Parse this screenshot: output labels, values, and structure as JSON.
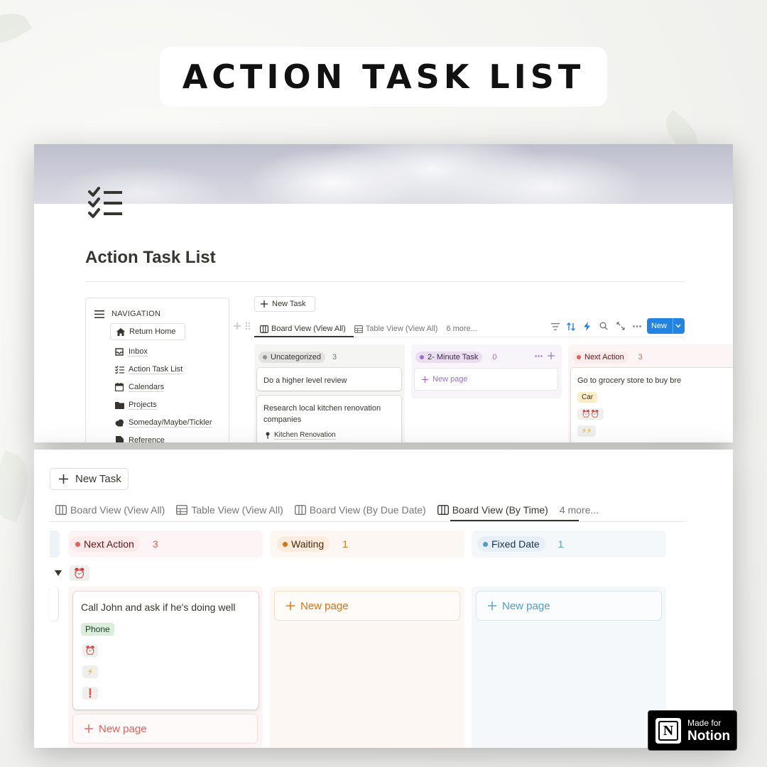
{
  "header": {
    "title": "ACTION TASK LIST"
  },
  "top": {
    "page_title": "Action Task List",
    "nav_heading": "NAVIGATION",
    "nav_items": [
      "Return Home",
      "Inbox",
      "Action Task List",
      "Calendars",
      "Projects",
      "Someday/Maybe/Tickler",
      "Reference"
    ],
    "new_task": "New Task",
    "tabs": [
      "Board View (View All)",
      "Table View (View All)",
      "6 more..."
    ],
    "new_button": "New",
    "columns": [
      {
        "label": "Uncategorized",
        "count": "3",
        "cards": [
          {
            "title": "Do a higher level review"
          },
          {
            "title": "Research local kitchen renovation companies",
            "relation": "Kitchen Renovation"
          }
        ]
      },
      {
        "label": "2- Minute Task",
        "count": "0",
        "new_page": "New page"
      },
      {
        "label": "Next Action",
        "count": "3",
        "cards": [
          {
            "title": "Go to grocery store to buy bre",
            "tag": "Car",
            "emoji1": "⏰⏰",
            "emoji2": "⚡⚡"
          }
        ]
      }
    ]
  },
  "bottom": {
    "new_task": "New Task",
    "tabs": [
      "Board View (View All)",
      "Table View (View All)",
      "Board View (By Due Date)",
      "Board View (By Time)",
      "4 more..."
    ],
    "group_icon": "⏰",
    "columns": [
      {
        "label": "Next Action",
        "count": "3",
        "new_page": "New page"
      },
      {
        "label": "Waiting",
        "count": "1",
        "new_page": "New page"
      },
      {
        "label": "Fixed Date",
        "count": "1",
        "new_page": "New page"
      }
    ],
    "card": {
      "title": "Call John and ask if he's doing well",
      "tag": "Phone",
      "emoji1": "⏰",
      "emoji2": "⚡",
      "emoji3": "❗"
    }
  },
  "badge": {
    "line1": "Made for",
    "line2": "Notion",
    "logo_letter": "N"
  },
  "colors": {
    "accent_blue": "#2383e2",
    "next_action": "#fdebec",
    "waiting": "#fbecdd",
    "fixed_date": "#e7f0f8",
    "purple": "#e8deee"
  }
}
